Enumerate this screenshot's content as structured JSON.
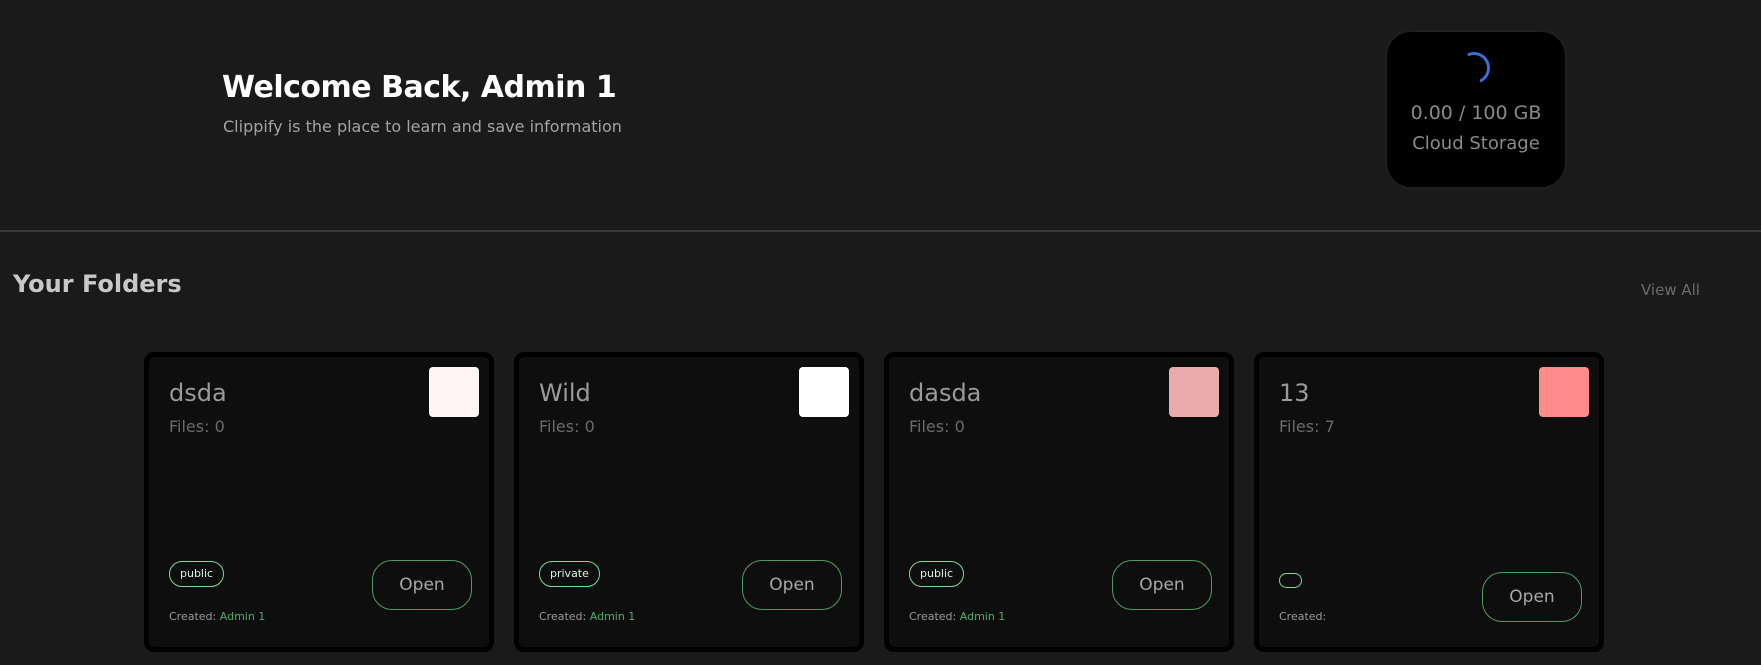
{
  "header": {
    "title": "Welcome Back, Admin 1",
    "subtitle": "Clippify is the place to learn and save information"
  },
  "storage": {
    "value": "0.00 / 100 GB",
    "label": "Cloud Storage",
    "spinner_color": "#3b6ed8"
  },
  "folders_section": {
    "title": "Your Folders",
    "view_all_label": "View All"
  },
  "folders": [
    {
      "name": "dsda",
      "files": "Files: 0",
      "color": "#fff5f5",
      "visibility": "public",
      "created_label": "Created:",
      "author": "Admin 1",
      "open_label": "Open"
    },
    {
      "name": "Wild",
      "files": "Files: 0",
      "color": "#ffffff",
      "visibility": "private",
      "created_label": "Created:",
      "author": "Admin 1",
      "open_label": "Open"
    },
    {
      "name": "dasda",
      "files": "Files: 0",
      "color": "#e8aaaa",
      "visibility": "public",
      "created_label": "Created:",
      "author": "Admin 1",
      "open_label": "Open"
    },
    {
      "name": "13",
      "files": "Files: 7",
      "color": "#ff8a8a",
      "visibility": "",
      "created_label": "Created:",
      "author": "",
      "open_label": "Open"
    }
  ]
}
